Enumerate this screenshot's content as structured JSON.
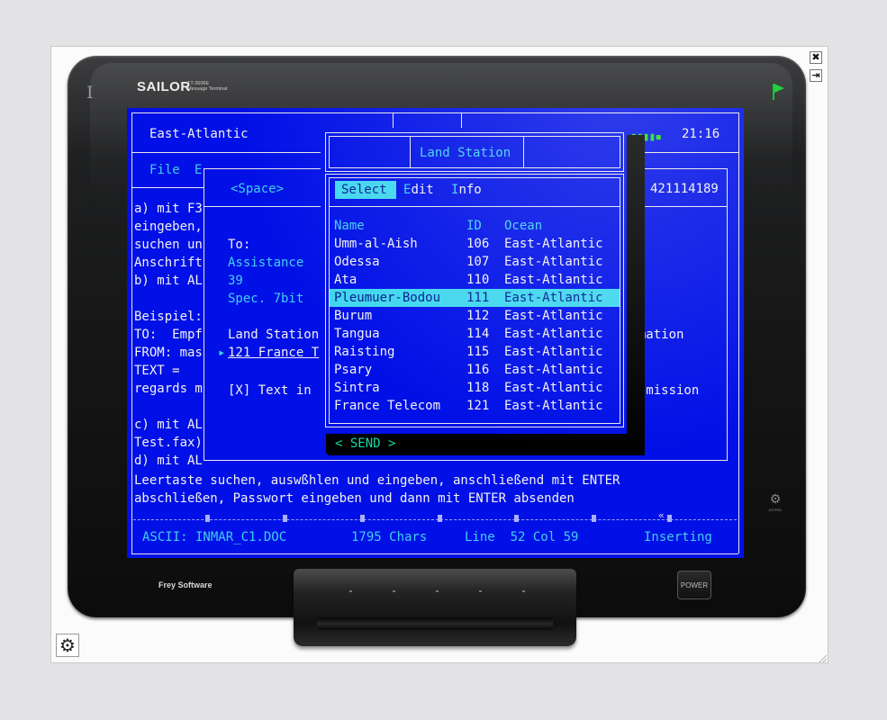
{
  "device": {
    "brand": "SAILOR",
    "model": "TT-3606E",
    "model_sub": "Message Terminal",
    "footer_brand": "Frey Software",
    "power_label": "POWER",
    "indicator": "I",
    "astrid_label": "ASTRID"
  },
  "header": {
    "region": "East-Atlantic",
    "time": "21:16",
    "signal": "▮▮▮▮▪"
  },
  "menu": {
    "file": "File",
    "edit_partial": "E"
  },
  "doc_lines": [
    "a) mit F3",
    "eingeben,",
    "suchen un",
    "Anschrift",
    "b) mit AL",
    "",
    "Beispiel:",
    "TO:  Empf",
    "FROM: mas",
    "TEXT =",
    "regards m",
    "",
    "c) mit AL",
    "Test.fax)",
    "d) mit AL"
  ],
  "bottom_lines": [
    "Leertaste suchen, auswßhlen und eingeben, anschließend mit ENTER",
    "abschließen, Passwort eingeben und dann mit ENTER absenden"
  ],
  "compose": {
    "space_label": "<Space>",
    "to_label": "To:",
    "to_value": "Assistance",
    "to_number": "39",
    "spec": "Spec. 7bit",
    "land_station_label": "Land Station",
    "land_station_value": "121 France T",
    "text_in": "[X] Text in",
    "right_number": "421114189",
    "right_text1": "irmation",
    "right_text2": "ansmission",
    "send": "< SEND >"
  },
  "popup": {
    "title": "Land Station",
    "menu_select": "Select",
    "menu_edit": "Edit",
    "menu_info": "Info",
    "col_name": "Name",
    "col_id": "ID",
    "col_ocean": "Ocean",
    "rows": [
      {
        "name": "Umm-al-Aish",
        "id": "106",
        "ocean": "East-Atlantic"
      },
      {
        "name": "Odessa",
        "id": "107",
        "ocean": "East-Atlantic"
      },
      {
        "name": "Ata",
        "id": "110",
        "ocean": "East-Atlantic"
      },
      {
        "name": "Pleumuer-Bodou",
        "id": "111",
        "ocean": "East-Atlantic"
      },
      {
        "name": "Burum",
        "id": "112",
        "ocean": "East-Atlantic"
      },
      {
        "name": "Tangua",
        "id": "114",
        "ocean": "East-Atlantic"
      },
      {
        "name": "Raisting",
        "id": "115",
        "ocean": "East-Atlantic"
      },
      {
        "name": "Psary",
        "id": "116",
        "ocean": "East-Atlantic"
      },
      {
        "name": "Sintra",
        "id": "118",
        "ocean": "East-Atlantic"
      },
      {
        "name": "France Telecom",
        "id": "121",
        "ocean": "East-Atlantic"
      }
    ],
    "selected_index": 3
  },
  "status": {
    "file": "ASCII: INMAR_C1.DOC",
    "chars": "1795 Chars",
    "position": "Line  52 Col 59",
    "mode": "Inserting",
    "ruler_marker": "«"
  },
  "window_controls": {
    "close": "✖",
    "pin": "⇥",
    "settings": "⚙"
  },
  "colors": {
    "screen_bg": "#0010e6",
    "cyan": "#40d6ee",
    "text": "#f2f2f2",
    "flag_green": "#22d040"
  }
}
